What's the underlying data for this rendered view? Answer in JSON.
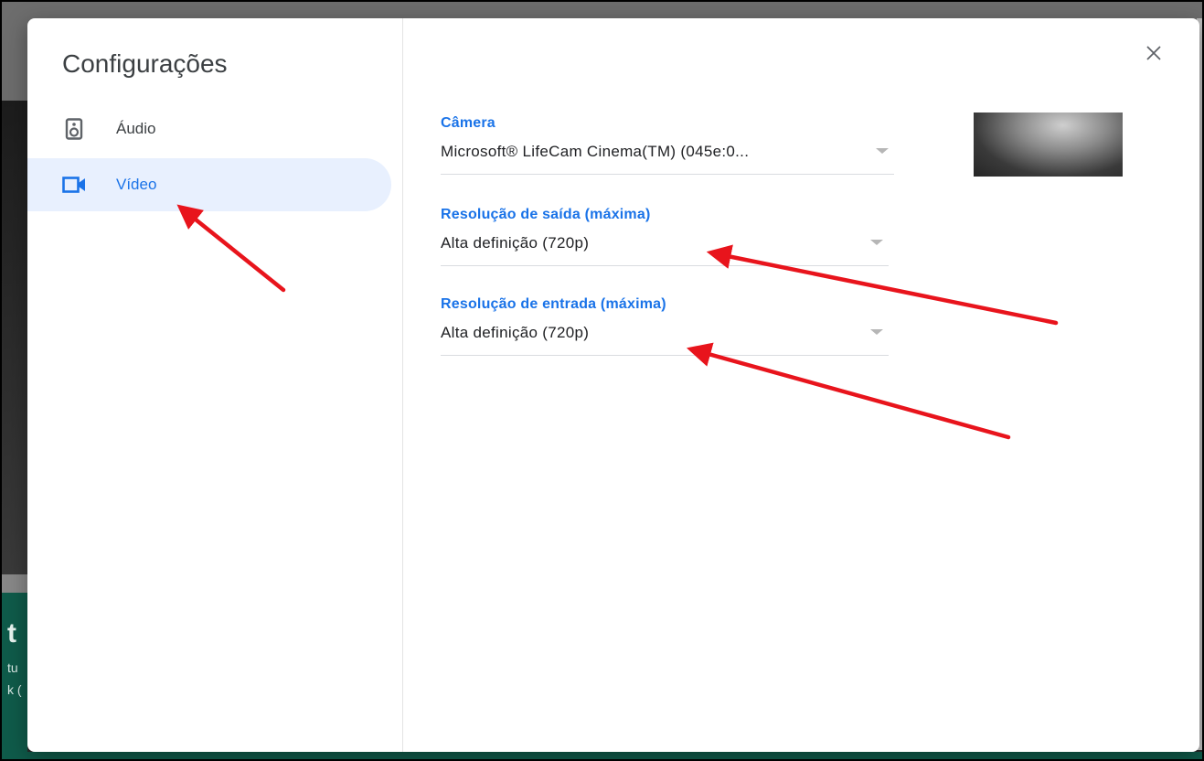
{
  "dialog": {
    "title": "Configurações",
    "close_icon": "close-icon"
  },
  "sidebar": {
    "items": [
      {
        "label": "Áudio",
        "icon": "speaker-icon",
        "selected": false
      },
      {
        "label": "Vídeo",
        "icon": "videocam-icon",
        "selected": true
      }
    ]
  },
  "video": {
    "camera": {
      "label": "Câmera",
      "value": "Microsoft® LifeCam Cinema(TM) (045e:0..."
    },
    "send_resolution": {
      "label": "Resolução de saída (máxima)",
      "value": "Alta definição (720p)"
    },
    "receive_resolution": {
      "label": "Resolução de entrada (máxima)",
      "value": "Alta definição (720p)"
    }
  },
  "background_fragments": [
    "t",
    "tu",
    "k ("
  ],
  "colors": {
    "accent": "#1a73e8",
    "selected_bg": "#e8f0fe",
    "annotation": "#e8141c"
  }
}
